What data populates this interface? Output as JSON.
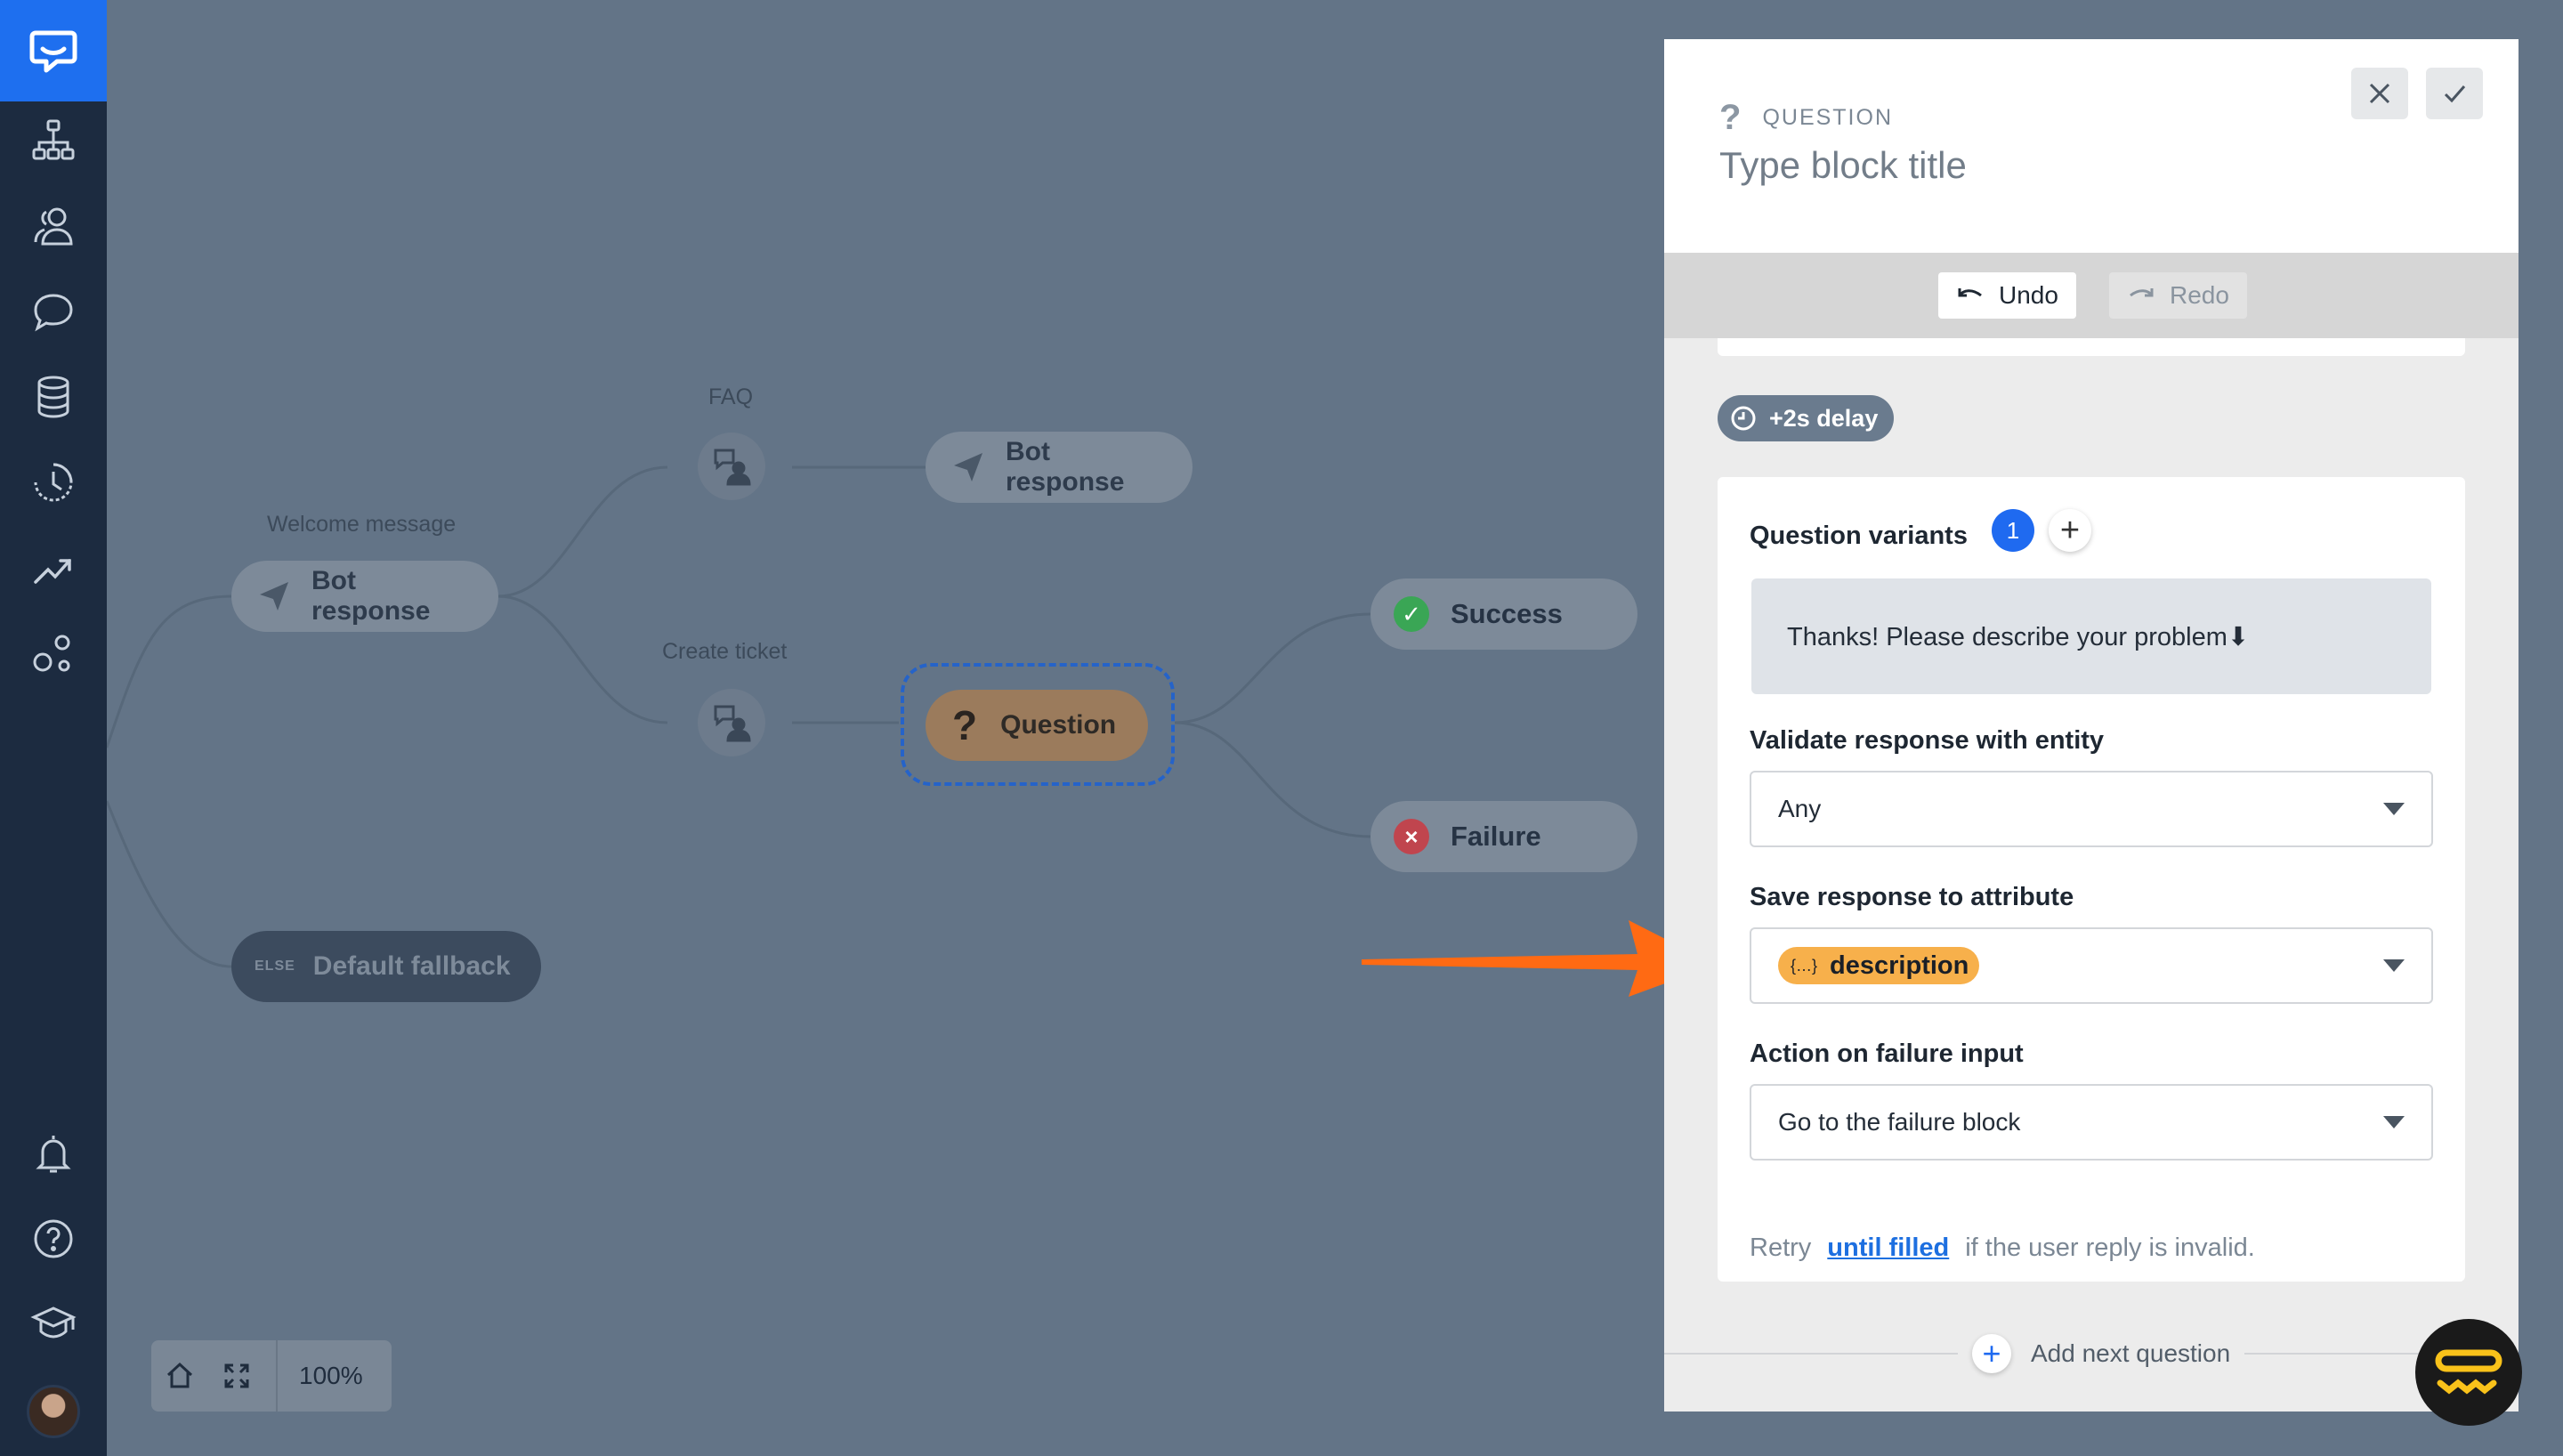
{
  "sidebar": {
    "items": [
      {
        "icon": "sitemap-icon"
      },
      {
        "icon": "users-icon"
      },
      {
        "icon": "chat-bubble-icon"
      },
      {
        "icon": "database-icon"
      },
      {
        "icon": "history-icon"
      },
      {
        "icon": "trending-up-icon"
      },
      {
        "icon": "integrations-icon"
      }
    ],
    "bottom": [
      {
        "icon": "bell-icon"
      },
      {
        "icon": "help-circle-icon"
      },
      {
        "icon": "graduation-cap-icon"
      }
    ]
  },
  "canvas": {
    "welcome_label": "Welcome message",
    "welcome_node": "Bot response",
    "faq_label": "FAQ",
    "faq_bot_response": "Bot response",
    "create_ticket_label": "Create ticket",
    "question_node": "Question",
    "success_node": "Success",
    "failure_node": "Failure",
    "fallback_else": "ELSE",
    "fallback_node": "Default fallback",
    "zoom": "100%"
  },
  "panel": {
    "block_type": "QUESTION",
    "title_placeholder": "Type block title",
    "undo_label": "Undo",
    "redo_label": "Redo",
    "delay": "+2s delay",
    "question_variants_label": "Question variants",
    "variants_count": "1",
    "variant_text": "Thanks! Please describe your problem⬇",
    "validate_label": "Validate response with entity",
    "validate_value": "Any",
    "save_label": "Save response to attribute",
    "save_value": "description",
    "failure_label": "Action on failure input",
    "failure_value": "Go to the failure block",
    "retry_prefix": "Retry",
    "retry_link": "until filled",
    "retry_suffix": "if the user reply is invalid.",
    "add_next": "Add next question"
  },
  "colors": {
    "sidebar_bg": "#1c2b40",
    "accent": "#1e6fef",
    "attribute_chip": "#f7b04b",
    "arrow": "#ff6a13",
    "success": "#3aa655",
    "failure": "#c0454e"
  }
}
